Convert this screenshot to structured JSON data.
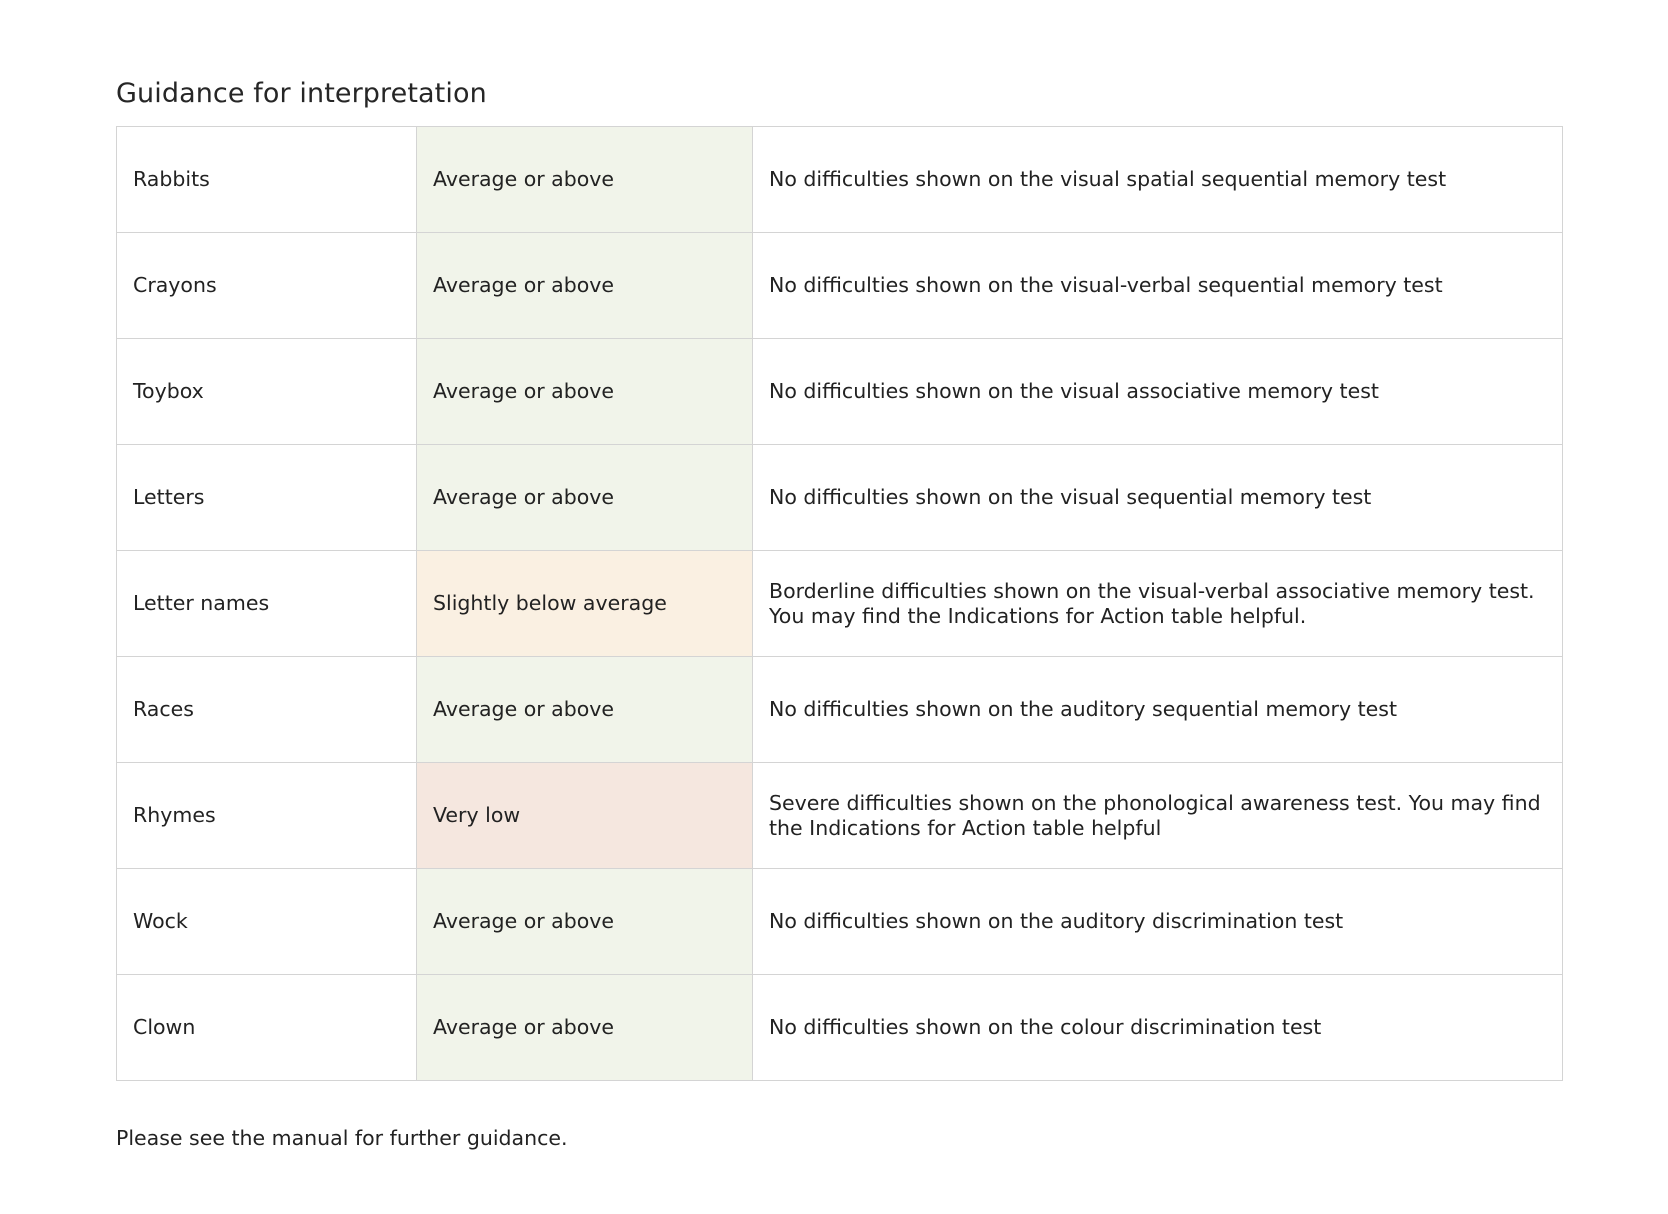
{
  "title": "Guidance for interpretation",
  "rows": [
    {
      "test": "Rabbits",
      "result": "Average or above",
      "level": "average",
      "description": "No difficulties shown on the visual spatial sequential memory test"
    },
    {
      "test": "Crayons",
      "result": "Average or above",
      "level": "average",
      "description": "No difficulties shown on the visual-verbal sequential memory test"
    },
    {
      "test": "Toybox",
      "result": "Average or above",
      "level": "average",
      "description": "No difficulties shown on the visual associative memory test"
    },
    {
      "test": "Letters",
      "result": "Average or above",
      "level": "average",
      "description": "No difficulties shown on the visual sequential memory test"
    },
    {
      "test": "Letter names",
      "result": "Slightly below average",
      "level": "slight",
      "description": "Borderline difficulties shown on the visual-verbal associative memory test.\nYou may find the Indications for Action table helpful."
    },
    {
      "test": "Races",
      "result": "Average or above",
      "level": "average",
      "description": "No difficulties shown on the auditory sequential memory test"
    },
    {
      "test": "Rhymes",
      "result": "Very low",
      "level": "verylow",
      "description": "Severe difficulties shown on the phonological awareness test. You may find the Indications for Action table helpful"
    },
    {
      "test": "Wock",
      "result": "Average or above",
      "level": "average",
      "description": "No difficulties shown on the auditory discrimination test"
    },
    {
      "test": "Clown",
      "result": "Average or above",
      "level": "average",
      "description": "No difficulties shown on the colour discrimination test"
    }
  ],
  "colors": {
    "average": "#f1f4ea",
    "slight": "#faf0e2",
    "verylow": "#f5e7df",
    "border": "#d4d4d4"
  },
  "footer_note": "Please see the manual for further guidance."
}
